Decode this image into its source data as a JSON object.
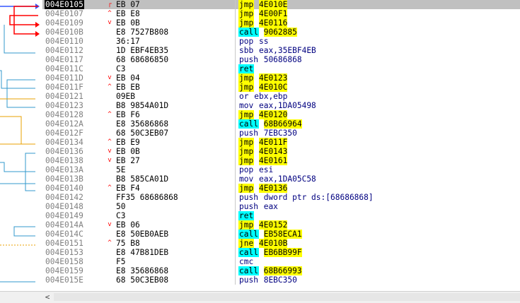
{
  "colors": {
    "selected_row_bg": "#c0c0c0",
    "selected_addr_bg": "#000000",
    "jmp_highlight": "#ffff00",
    "call_highlight": "#00ffff",
    "arrow_red": "#ff0000",
    "arrow_blue": "#3399cc",
    "arrow_orange": "#e8a000"
  },
  "scrollbar": {
    "left_arrow": "<"
  },
  "rows": [
    {
      "addr": "004E0105",
      "mark": "┌",
      "bytes": "EB 07",
      "mnemonic": "jmp",
      "operand": "4E010E",
      "kind": "jmp",
      "selected": true
    },
    {
      "addr": "004E0107",
      "mark": "^",
      "bytes": "EB E8",
      "mnemonic": "jmp",
      "operand": "4E00F1",
      "kind": "jmp"
    },
    {
      "addr": "004E0109",
      "mark": "v",
      "bytes": "EB 0B",
      "mnemonic": "jmp",
      "operand": "4E0116",
      "kind": "jmp"
    },
    {
      "addr": "004E010B",
      "mark": "",
      "bytes": "E8 7527B808",
      "mnemonic": "call",
      "operand": "9062885",
      "kind": "call"
    },
    {
      "addr": "004E0110",
      "mark": "",
      "bytes": "36:17",
      "mnemonic": "pop",
      "operand": "ss",
      "kind": "plain"
    },
    {
      "addr": "004E0112",
      "mark": "",
      "bytes": "1D EBF4EB35",
      "mnemonic": "sbb",
      "operand": "eax,35EBF4EB",
      "kind": "plain"
    },
    {
      "addr": "004E0117",
      "mark": "",
      "bytes": "68 68686850",
      "mnemonic": "push",
      "operand": "50686868",
      "kind": "plain"
    },
    {
      "addr": "004E011C",
      "mark": "",
      "bytes": "C3",
      "mnemonic": "ret",
      "operand": "",
      "kind": "ret"
    },
    {
      "addr": "004E011D",
      "mark": "v",
      "bytes": "EB 04",
      "mnemonic": "jmp",
      "operand": "4E0123",
      "kind": "jmp"
    },
    {
      "addr": "004E011F",
      "mark": "^",
      "bytes": "EB EB",
      "mnemonic": "jmp",
      "operand": "4E010C",
      "kind": "jmp"
    },
    {
      "addr": "004E0121",
      "mark": "",
      "bytes": "09EB",
      "mnemonic": "or",
      "operand": "ebx,ebp",
      "kind": "plain"
    },
    {
      "addr": "004E0123",
      "mark": "",
      "bytes": "B8 9854A01D",
      "mnemonic": "mov",
      "operand": "eax,1DA05498",
      "kind": "plain"
    },
    {
      "addr": "004E0128",
      "mark": "^",
      "bytes": "EB F6",
      "mnemonic": "jmp",
      "operand": "4E0120",
      "kind": "jmp"
    },
    {
      "addr": "004E012A",
      "mark": "",
      "bytes": "E8 35686868",
      "mnemonic": "call",
      "operand": "68B66964",
      "kind": "call"
    },
    {
      "addr": "004E012F",
      "mark": "",
      "bytes": "68 50C3EB07",
      "mnemonic": "push",
      "operand": "7EBC350",
      "kind": "plain"
    },
    {
      "addr": "004E0134",
      "mark": "^",
      "bytes": "EB E9",
      "mnemonic": "jmp",
      "operand": "4E011F",
      "kind": "jmp"
    },
    {
      "addr": "004E0136",
      "mark": "v",
      "bytes": "EB 0B",
      "mnemonic": "jmp",
      "operand": "4E0143",
      "kind": "jmp"
    },
    {
      "addr": "004E0138",
      "mark": "v",
      "bytes": "EB 27",
      "mnemonic": "jmp",
      "operand": "4E0161",
      "kind": "jmp"
    },
    {
      "addr": "004E013A",
      "mark": "",
      "bytes": "5E",
      "mnemonic": "pop",
      "operand": "esi",
      "kind": "plain"
    },
    {
      "addr": "004E013B",
      "mark": "",
      "bytes": "B8 585CA01D",
      "mnemonic": "mov",
      "operand": "eax,1DA05C58",
      "kind": "plain"
    },
    {
      "addr": "004E0140",
      "mark": "^",
      "bytes": "EB F4",
      "mnemonic": "jmp",
      "operand": "4E0136",
      "kind": "jmp"
    },
    {
      "addr": "004E0142",
      "mark": "",
      "bytes": "FF35 68686868",
      "mnemonic": "push",
      "operand": "dword ptr ds:[68686868]",
      "kind": "plain"
    },
    {
      "addr": "004E0148",
      "mark": "",
      "bytes": "50",
      "mnemonic": "push",
      "operand": "eax",
      "kind": "plain"
    },
    {
      "addr": "004E0149",
      "mark": "",
      "bytes": "C3",
      "mnemonic": "ret",
      "operand": "",
      "kind": "ret"
    },
    {
      "addr": "004E014A",
      "mark": "v",
      "bytes": "EB 06",
      "mnemonic": "jmp",
      "operand": "4E0152",
      "kind": "jmp"
    },
    {
      "addr": "004E014C",
      "mark": "",
      "bytes": "E8 50EB0AEB",
      "mnemonic": "call",
      "operand": "EB58ECA1",
      "kind": "call"
    },
    {
      "addr": "004E0151",
      "mark": "^",
      "bytes": "75 B8",
      "mnemonic": "jne",
      "operand": "4E010B",
      "kind": "jmp"
    },
    {
      "addr": "004E0153",
      "mark": "",
      "bytes": "E8 47B81DEB",
      "mnemonic": "call",
      "operand": "EB6BB99F",
      "kind": "call"
    },
    {
      "addr": "004E0158",
      "mark": "",
      "bytes": "F5",
      "mnemonic": "cmc",
      "operand": "",
      "kind": "plain"
    },
    {
      "addr": "004E0159",
      "mark": "",
      "bytes": "E8 35686868",
      "mnemonic": "call",
      "operand": "68B66993",
      "kind": "call"
    },
    {
      "addr": "004E015E",
      "mark": "",
      "bytes": "68 50C3EB08",
      "mnemonic": "push",
      "operand": "8EBC350",
      "kind": "plain"
    }
  ]
}
